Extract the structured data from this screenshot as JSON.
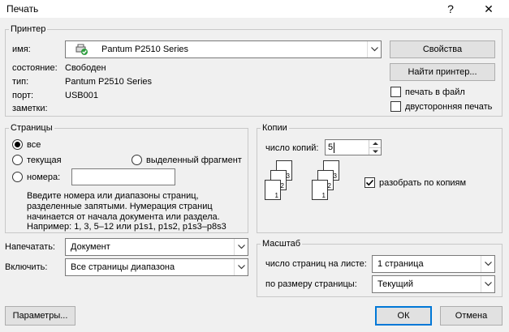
{
  "window": {
    "title": "Печать",
    "help_label": "?",
    "close_label": "✕"
  },
  "printer": {
    "group_label": "Принтер",
    "name_label": "имя:",
    "name_value": "Pantum P2510 Series",
    "status_label": "состояние:",
    "status_value": "Свободен",
    "type_label": "тип:",
    "type_value": "Pantum P2510 Series",
    "port_label": "порт:",
    "port_value": "USB001",
    "notes_label": "заметки:",
    "properties_button": "Свойства",
    "find_button": "Найти принтер...",
    "print_to_file": {
      "label": "печать в файл",
      "checked": false
    },
    "duplex": {
      "label": "двусторонняя печать",
      "checked": false
    }
  },
  "pages": {
    "group_label": "Страницы",
    "all_label": "все",
    "current_label": "текущая",
    "selection_label": "выделенный фрагмент",
    "numbers_label": "номера:",
    "numbers_value": "",
    "selected": "all",
    "hint_line1": "Введите номера или диапазоны страниц,",
    "hint_line2": "разделенные запятыми. Нумерация страниц",
    "hint_line3": "начинается от начала документа или раздела.",
    "hint_line4": "Например: 1, 3, 5–12 или p1s1, p1s2, p1s3–p8s3"
  },
  "copies": {
    "group_label": "Копии",
    "count_label": "число копий:",
    "count_value": "5",
    "collate": {
      "label": "разобрать по копиям",
      "checked": true
    },
    "page_numbers": [
      "1",
      "2",
      "3"
    ]
  },
  "print_what": {
    "label": "Напечатать:",
    "value": "Документ"
  },
  "include": {
    "label": "Включить:",
    "value": "Все страницы диапазона"
  },
  "zoom": {
    "group_label": "Масштаб",
    "pages_per_sheet_label": "число страниц на листе:",
    "pages_per_sheet_value": "1 страница",
    "scale_label": "по размеру страницы:",
    "scale_value": "Текущий"
  },
  "footer": {
    "options_button": "Параметры...",
    "ok_button": "ОК",
    "cancel_button": "Отмена"
  }
}
